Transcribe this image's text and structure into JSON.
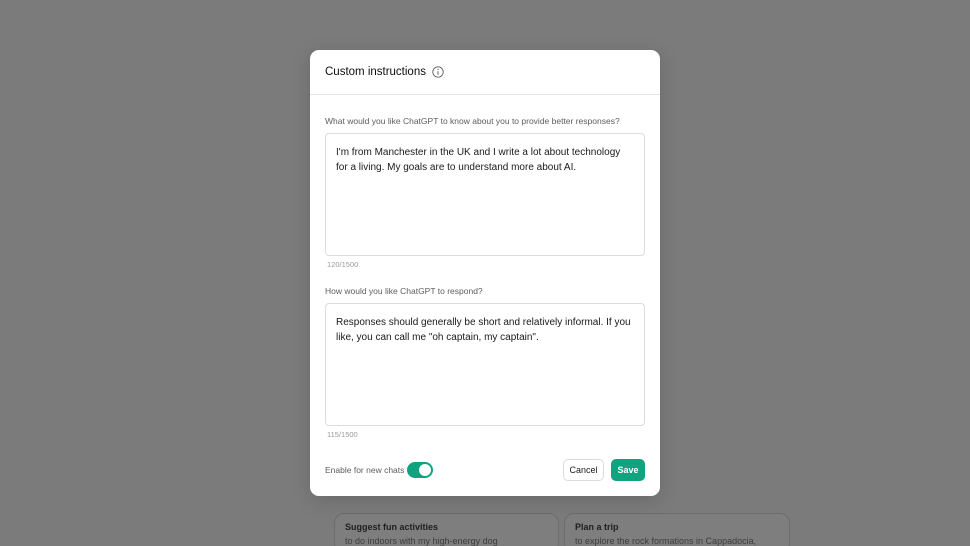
{
  "background_cards": [
    {
      "title": "Suggest fun activities",
      "subtitle": "to do indoors with my high-energy dog"
    },
    {
      "title": "Plan a trip",
      "subtitle": "to explore the rock formations in Cappadocia, Turkey"
    }
  ],
  "modal": {
    "title": "Custom instructions",
    "about_you": {
      "label": "What would you like ChatGPT to know about you to provide better responses?",
      "value": "I'm from Manchester in the UK and I write a lot about technology for a living. My goals are to understand more about AI.",
      "counter": "120/1500"
    },
    "response_style": {
      "label": "How would you like ChatGPT to respond?",
      "value": "Responses should generally be short and relatively informal. If you like, you can call me \"oh captain, my captain\".",
      "counter": "115/1500"
    },
    "enable_label": "Enable for new chats",
    "enable_on": true,
    "cancel_label": "Cancel",
    "save_label": "Save"
  },
  "colors": {
    "accent": "#10a37f",
    "overlay_bg": "#7b7b7b"
  }
}
